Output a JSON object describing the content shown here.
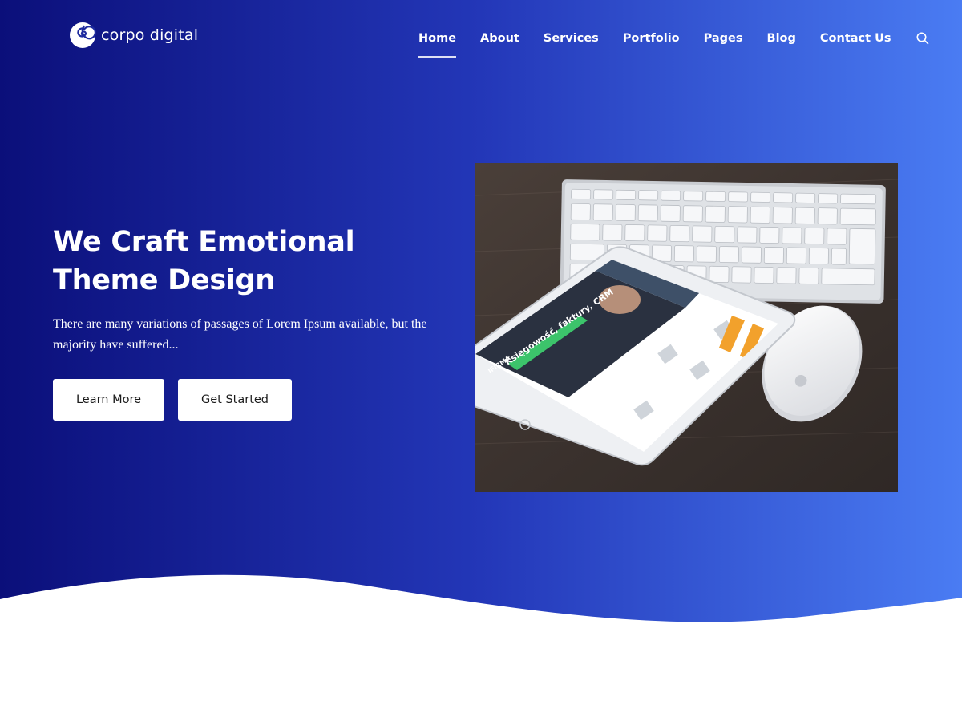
{
  "brand": {
    "name": "corpo digital",
    "logo_icon": "spiral-icon"
  },
  "nav": {
    "items": [
      {
        "label": "Home",
        "active": true
      },
      {
        "label": "About",
        "active": false
      },
      {
        "label": "Services",
        "active": false
      },
      {
        "label": "Portfolio",
        "active": false
      },
      {
        "label": "Pages",
        "active": false
      },
      {
        "label": "Blog",
        "active": false
      },
      {
        "label": "Contact Us",
        "active": false
      }
    ],
    "search_icon": "search-icon"
  },
  "hero": {
    "title_line1": "We Craft Emotional",
    "title_line2": "Theme Design",
    "description": "There are many variations of passages of Lorem Ipsum available, but the majority have suffered...",
    "buttons": {
      "learn_more": "Learn More",
      "get_started": "Get Started"
    },
    "image": {
      "tablet_headline": "Księgowość, faktury, CRM",
      "tablet_brand": "IFIRMA"
    }
  },
  "colors": {
    "gradient_start": "#0b0f7a",
    "gradient_mid": "#2337b8",
    "gradient_end": "#4a7cf3",
    "button_bg": "#ffffff",
    "text_light": "#ffffff",
    "text_dark": "#1b1b1b"
  }
}
